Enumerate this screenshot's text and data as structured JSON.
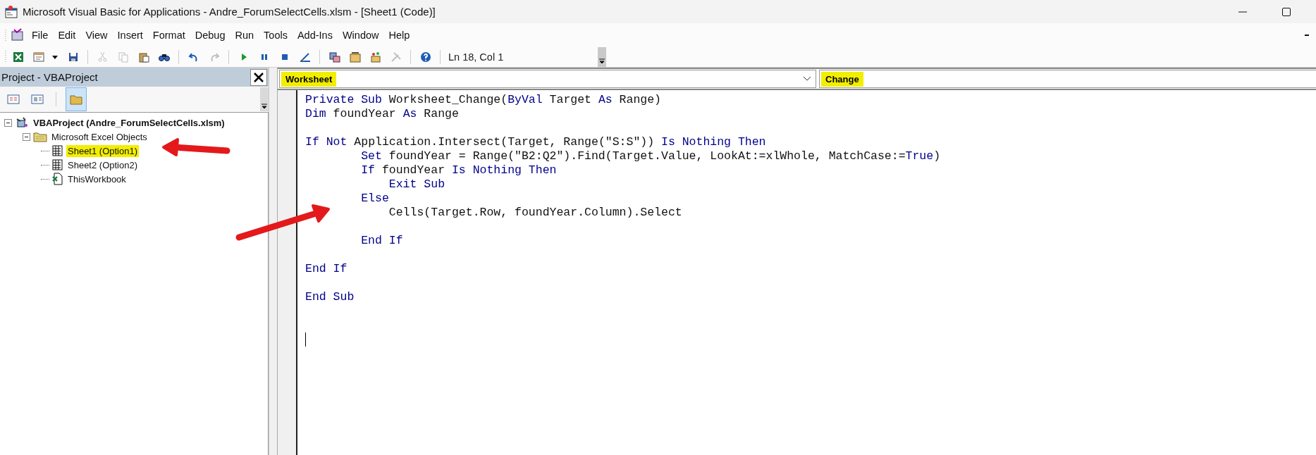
{
  "window": {
    "title": "Microsoft Visual Basic for Applications - Andre_ForumSelectCells.xlsm - [Sheet1 (Code)]"
  },
  "menu": [
    {
      "label": "File"
    },
    {
      "label": "Edit"
    },
    {
      "label": "View"
    },
    {
      "label": "Insert"
    },
    {
      "label": "Format"
    },
    {
      "label": "Debug"
    },
    {
      "label": "Run"
    },
    {
      "label": "Tools"
    },
    {
      "label": "Add-Ins"
    },
    {
      "label": "Window"
    },
    {
      "label": "Help"
    }
  ],
  "toolbar": {
    "buttons": [
      {
        "kind": "excel",
        "disabled": false
      },
      {
        "kind": "userform",
        "disabled": false
      },
      {
        "kind": "dropdown",
        "disabled": false
      },
      {
        "kind": "save",
        "disabled": false
      },
      {
        "kind": "separator"
      },
      {
        "kind": "cut",
        "disabled": true
      },
      {
        "kind": "copy",
        "disabled": true
      },
      {
        "kind": "paste",
        "disabled": false
      },
      {
        "kind": "find",
        "disabled": false
      },
      {
        "kind": "separator"
      },
      {
        "kind": "undo",
        "disabled": false
      },
      {
        "kind": "redo",
        "disabled": true
      },
      {
        "kind": "separator"
      },
      {
        "kind": "run",
        "disabled": false
      },
      {
        "kind": "pause",
        "disabled": false
      },
      {
        "kind": "stop",
        "disabled": false
      },
      {
        "kind": "design",
        "disabled": false
      },
      {
        "kind": "separator"
      },
      {
        "kind": "explorer",
        "disabled": false
      },
      {
        "kind": "properties",
        "disabled": false
      },
      {
        "kind": "browser",
        "disabled": false
      },
      {
        "kind": "toolbox",
        "disabled": true
      },
      {
        "kind": "separator"
      },
      {
        "kind": "help",
        "disabled": false
      }
    ],
    "position": "Ln 18, Col 1"
  },
  "project_pane": {
    "title": "Project - VBAProject",
    "tools": [
      {
        "kind": "view-code",
        "selected": false
      },
      {
        "kind": "view-object",
        "selected": false
      },
      {
        "kind": "folders",
        "selected": true
      }
    ],
    "tree": [
      {
        "label": "VBAProject (Andre_ForumSelectCells.xlsm)",
        "kind": "project",
        "expanded": true,
        "selected": false,
        "highlighted": false,
        "children": [
          {
            "label": "Microsoft Excel Objects",
            "kind": "folder",
            "expanded": true,
            "selected": false,
            "highlighted": false,
            "children": [
              {
                "label": "Sheet1 (Option1)",
                "kind": "sheet",
                "selected": true,
                "highlighted": true
              },
              {
                "label": "Sheet2 (Option2)",
                "kind": "sheet",
                "selected": false,
                "highlighted": false
              },
              {
                "label": "ThisWorkbook",
                "kind": "workbook",
                "selected": false,
                "highlighted": false
              }
            ]
          }
        ]
      }
    ]
  },
  "code_window": {
    "object": {
      "value": "Worksheet",
      "highlighted": true
    },
    "procedure": {
      "value": "Change",
      "highlighted": true
    },
    "lines": [
      {
        "kind": "code",
        "segments": [
          {
            "text": "Private Sub",
            "kind": "keyword"
          },
          {
            "text": " Worksheet_Change(",
            "kind": "plain"
          },
          {
            "text": "ByVal",
            "kind": "keyword"
          },
          {
            "text": " Target ",
            "kind": "plain"
          },
          {
            "text": "As",
            "kind": "keyword"
          },
          {
            "text": " Range)",
            "kind": "plain"
          }
        ]
      },
      {
        "kind": "code",
        "segments": [
          {
            "text": "Dim",
            "kind": "keyword"
          },
          {
            "text": " foundYear ",
            "kind": "plain"
          },
          {
            "text": "As",
            "kind": "keyword"
          },
          {
            "text": " Range",
            "kind": "plain"
          }
        ]
      },
      {
        "kind": "blank"
      },
      {
        "kind": "code",
        "segments": [
          {
            "text": "If Not",
            "kind": "keyword"
          },
          {
            "text": " Application.Intersect(Target, Range(\"S:S\")) ",
            "kind": "plain"
          },
          {
            "text": "Is Nothing Then",
            "kind": "keyword"
          }
        ]
      },
      {
        "kind": "code",
        "segments": [
          {
            "text": "        Set",
            "kind": "keyword"
          },
          {
            "text": " foundYear = Range(\"B2:Q2\").Find(Target.Value, LookAt:=xlWhole, MatchCase:=",
            "kind": "plain"
          },
          {
            "text": "True",
            "kind": "keyword"
          },
          {
            "text": ")",
            "kind": "plain"
          }
        ]
      },
      {
        "kind": "code",
        "segments": [
          {
            "text": "        If",
            "kind": "keyword"
          },
          {
            "text": " foundYear ",
            "kind": "plain"
          },
          {
            "text": "Is Nothing Then",
            "kind": "keyword"
          }
        ]
      },
      {
        "kind": "code",
        "segments": [
          {
            "text": "            Exit Sub",
            "kind": "keyword"
          }
        ]
      },
      {
        "kind": "code",
        "segments": [
          {
            "text": "        Else",
            "kind": "keyword"
          }
        ]
      },
      {
        "kind": "code",
        "segments": [
          {
            "text": "            Cells(Target.Row, foundYear.Column).Select",
            "kind": "plain"
          }
        ]
      },
      {
        "kind": "blank"
      },
      {
        "kind": "code",
        "segments": [
          {
            "text": "        End If",
            "kind": "keyword"
          }
        ]
      },
      {
        "kind": "blank"
      },
      {
        "kind": "code",
        "segments": [
          {
            "text": "End If",
            "kind": "keyword"
          }
        ]
      },
      {
        "kind": "blank"
      },
      {
        "kind": "code",
        "segments": [
          {
            "text": "End Sub",
            "kind": "keyword"
          }
        ]
      },
      {
        "kind": "blank"
      },
      {
        "kind": "blank"
      },
      {
        "kind": "caret"
      }
    ]
  },
  "annotations": [
    {
      "kind": "arrow"
    },
    {
      "kind": "arrow"
    }
  ]
}
